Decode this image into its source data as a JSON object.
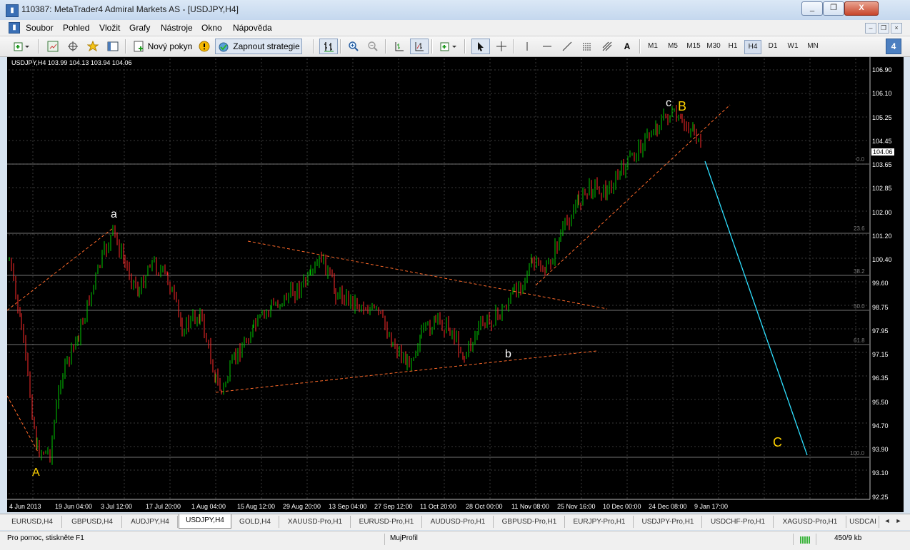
{
  "window": {
    "title": "110387: MetaTrader4 Admiral Markets AS - [USDJPY,H4]",
    "btn_minimize": "_",
    "btn_restore": "❐",
    "btn_close": "X"
  },
  "menu": {
    "items": [
      "Soubor",
      "Pohled",
      "Vložit",
      "Grafy",
      "Nástroje",
      "Okno",
      "Nápověda"
    ],
    "mdi_minimize": "–",
    "mdi_restore": "❐",
    "mdi_close": "×"
  },
  "toolbar": {
    "new_order_label": "Nový pokyn",
    "strategy_label": "Zapnout strategie",
    "timeframes": [
      "M1",
      "M5",
      "M15",
      "M30",
      "H1",
      "H4",
      "D1",
      "W1",
      "MN"
    ],
    "active_timeframe": "H4",
    "badge": "4"
  },
  "chart": {
    "symbol_info": "USDJPY,H4  103.99 104.13 103.94 104.06",
    "current_price": "104.06",
    "price_ticks": [
      "106.90",
      "106.10",
      "105.25",
      "104.45",
      "103.65",
      "102.85",
      "102.00",
      "101.20",
      "100.40",
      "99.60",
      "98.75",
      "97.95",
      "97.15",
      "96.35",
      "95.50",
      "94.70",
      "93.90",
      "93.10",
      "92.25"
    ],
    "date_ticks": [
      "4 Jun 2013",
      "19 Jun 04:00",
      "3 Jul 12:00",
      "17 Jul 20:00",
      "1 Aug 04:00",
      "15 Aug 12:00",
      "29 Aug 20:00",
      "13 Sep 04:00",
      "27 Sep 12:00",
      "11 Oct 20:00",
      "28 Oct 00:00",
      "11 Nov 08:00",
      "25 Nov 16:00",
      "10 Dec 00:00",
      "24 Dec 08:00",
      "9 Jan 17:00"
    ],
    "fib_levels": [
      "0.0",
      "23.6",
      "38.2",
      "50.0",
      "61.8",
      "100.0"
    ],
    "wave_labels": {
      "A": "A",
      "a": "a",
      "b": "b",
      "c": "c",
      "B": "B",
      "C": "C"
    },
    "colors": {
      "background": "#000000",
      "bull": "#00c800",
      "bear": "#ff2a2a",
      "trend": "#ff6a2a",
      "projection": "#2ee0ff",
      "wave_yellow": "#ffd200"
    }
  },
  "tabs": {
    "items": [
      "EURUSD,H4",
      "GBPUSD,H4",
      "AUDJPY,H4",
      "USDJPY,H4",
      "GOLD,H4",
      "XAUUSD-Pro,H1",
      "EURUSD-Pro,H1",
      "AUDUSD-Pro,H1",
      "GBPUSD-Pro,H1",
      "EURJPY-Pro,H1",
      "USDJPY-Pro,H1",
      "USDCHF-Pro,H1",
      "XAGUSD-Pro,H1",
      "USDCAI"
    ],
    "active": "USDJPY,H4",
    "nav_left": "◄",
    "nav_right": "►"
  },
  "status": {
    "help": "Pro pomoc, stiskněte F1",
    "profile": "MujProfil",
    "traffic": "450/9 kb"
  }
}
